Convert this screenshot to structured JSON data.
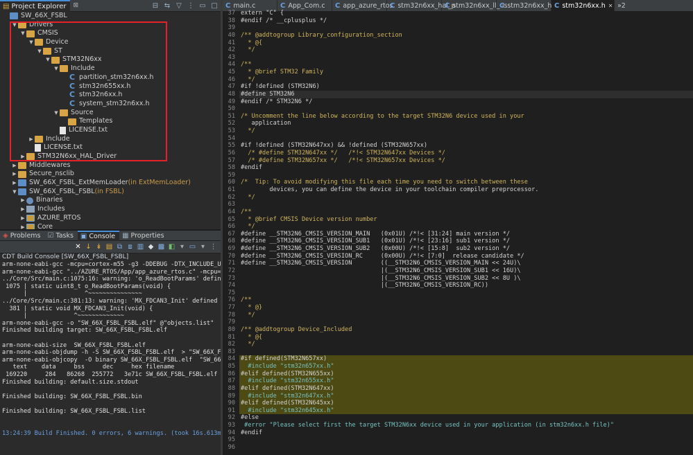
{
  "explorer": {
    "tabs": [
      {
        "label": "Project Explorer",
        "active": true
      },
      {
        "label": "⊠"
      }
    ],
    "tree": [
      {
        "label": "SW_66X_FSBL",
        "depth": 0,
        "icon": "project",
        "arrow": ""
      },
      {
        "label": "Drivers",
        "depth": 1,
        "icon": "folder",
        "arrow": "down"
      },
      {
        "label": "CMSIS",
        "depth": 2,
        "icon": "folder",
        "arrow": "down"
      },
      {
        "label": "Device",
        "depth": 3,
        "icon": "folder",
        "arrow": "down"
      },
      {
        "label": "ST",
        "depth": 4,
        "icon": "folder",
        "arrow": "down"
      },
      {
        "label": "STM32N6xx",
        "depth": 5,
        "icon": "folder",
        "arrow": "down"
      },
      {
        "label": "Include",
        "depth": 6,
        "icon": "folder",
        "arrow": "down"
      },
      {
        "label": "partition_stm32n6xx.h",
        "depth": 7,
        "icon": "c-file",
        "arrow": ""
      },
      {
        "label": "stm32n655xx.h",
        "depth": 7,
        "icon": "c-file",
        "arrow": ""
      },
      {
        "label": "stm32n6xx.h",
        "depth": 7,
        "icon": "c-file",
        "arrow": ""
      },
      {
        "label": "system_stm32n6xx.h",
        "depth": 7,
        "icon": "c-file",
        "arrow": ""
      },
      {
        "label": "Source",
        "depth": 6,
        "icon": "folder",
        "arrow": "down"
      },
      {
        "label": "Templates",
        "depth": 7,
        "icon": "folder",
        "arrow": ""
      },
      {
        "label": "LICENSE.txt",
        "depth": 6,
        "icon": "txt-file",
        "arrow": ""
      },
      {
        "label": "Include",
        "depth": 3,
        "icon": "folder",
        "arrow": "right"
      },
      {
        "label": "LICENSE.txt",
        "depth": 3,
        "icon": "txt-file",
        "arrow": ""
      },
      {
        "label": "STM32N6xx_HAL_Driver",
        "depth": 2,
        "icon": "folder",
        "arrow": "right"
      },
      {
        "label": "Middlewares",
        "depth": 1,
        "icon": "folder",
        "arrow": "right"
      },
      {
        "label": "Secure_nsclib",
        "depth": 1,
        "icon": "folder",
        "arrow": "right"
      },
      {
        "label": "SW_66X_FSBL_ExtMemLoader",
        "suffix": " (in ExtMemLoader)",
        "depth": 1,
        "icon": "project",
        "arrow": "right"
      },
      {
        "label": "SW_66X_FSBL_FSBL",
        "suffix": " (in FSBL)",
        "depth": 1,
        "icon": "project",
        "arrow": "down"
      },
      {
        "label": "Binaries",
        "depth": 2,
        "icon": "binaries",
        "arrow": "right"
      },
      {
        "label": "Includes",
        "depth": 2,
        "icon": "includes",
        "arrow": "right"
      },
      {
        "label": "AZURE_RTOS",
        "depth": 2,
        "icon": "folder-src",
        "arrow": "right"
      },
      {
        "label": "Core",
        "depth": 2,
        "icon": "folder-src",
        "arrow": "right"
      }
    ]
  },
  "console": {
    "tabs": [
      {
        "label": "Problems",
        "icon": "problems-icon"
      },
      {
        "label": "Tasks",
        "icon": "tasks-icon"
      },
      {
        "label": "Console",
        "icon": "console-icon",
        "active": true
      },
      {
        "label": "Properties",
        "icon": "properties-icon"
      }
    ],
    "title": "CDT Build Console [SW_66X_FSBL_FSBL]",
    "lines": [
      "arm-none-eabi-gcc -mcpu=cortex-m55 -g3 -DDEBUG -DTX_INCLUDE_USE",
      "arm-none-eabi-gcc \"../AZURE_RTOS/App/app_azure_rtos.c\" -mcpu=co",
      "../Core/Src/main.c:1075:16: warning: 'o_ReadBootParams' defined",
      " 1075 | static uint8_t o_ReadBootParams(void) {",
      "      |                ^~~~~~~~~~~~~~~~",
      "../Core/Src/main.c:381:13: warning: 'MX_FDCAN3_Init' defined bu",
      "  381 | static void MX_FDCAN3_Init(void) {",
      "      |             ^~~~~~~~~~~~~~",
      "arm-none-eabi-gcc -o \"SW_66X_FSBL_FSBL.elf\" @\"objects.list\"  -",
      "Finished building target: SW_66X_FSBL_FSBL.elf",
      "",
      "arm-none-eabi-size  SW_66X_FSBL_FSBL.elf",
      "arm-none-eabi-objdump -h -S SW_66X_FSBL_FSBL.elf  > \"SW_66X_FSB",
      "arm-none-eabi-objcopy  -O binary SW_66X_FSBL_FSBL.elf  \"SW_66X_",
      "   text    data     bss     dec     hex filename",
      " 169220     284   86268  255772   3e71c SW_66X_FSBL_FSBL.elf",
      "Finished building: default.size.stdout",
      "",
      "Finished building: SW_66X_FSBL_FSBL.bin",
      "",
      "Finished building: SW_66X_FSBL_FSBL.list",
      "",
      "",
      "13:24:39 Build Finished. 0 errors, 6 warnings. (took 16s.613ms)"
    ]
  },
  "editor": {
    "tabs": [
      {
        "label": "main.c"
      },
      {
        "label": "App_Com.c"
      },
      {
        "label": "app_azure_rtos."
      },
      {
        "label": "stm32n6xx_hal_p"
      },
      {
        "label": "stm32n6xx_ll_us"
      },
      {
        "label": "stm32n6xx_hal_d"
      },
      {
        "label": "stm32n6xx.h",
        "active": true
      },
      {
        "label": "»2",
        "overflow": true
      }
    ],
    "lines": [
      {
        "n": "37",
        "t": "extern \"C\" {"
      },
      {
        "n": "38",
        "t": "#endif /* __cplusplus */"
      },
      {
        "n": "39",
        "t": ""
      },
      {
        "n": "40",
        "t": "/** @addtogroup Library_configuration_section"
      },
      {
        "n": "41",
        "t": "  * @{"
      },
      {
        "n": "42",
        "t": "  */"
      },
      {
        "n": "43",
        "t": ""
      },
      {
        "n": "44",
        "t": "/**"
      },
      {
        "n": "45",
        "t": "  * @brief STM32 Family"
      },
      {
        "n": "46",
        "t": "  */"
      },
      {
        "n": "47",
        "t": "#if !defined (STM32N6)"
      },
      {
        "n": "48",
        "t": "#define STM32N6",
        "cur": true
      },
      {
        "n": "49",
        "t": "#endif /* STM32N6 */"
      },
      {
        "n": "50",
        "t": ""
      },
      {
        "n": "51",
        "t": "/* Uncomment the line below according to the target STM32N6 device used in your"
      },
      {
        "n": "52",
        "t": "   application"
      },
      {
        "n": "53",
        "t": "  */"
      },
      {
        "n": "54",
        "t": ""
      },
      {
        "n": "55",
        "t": "#if !defined (STM32N647xx) && !defined (STM32N657xx)"
      },
      {
        "n": "56",
        "t": "  /* #define STM32N647xx */   /*!< STM32N647xx Devices */"
      },
      {
        "n": "57",
        "t": "  /* #define STM32N657xx */   /*!< STM32N657xx Devices */"
      },
      {
        "n": "58",
        "t": "#endif"
      },
      {
        "n": "59",
        "t": ""
      },
      {
        "n": "60",
        "t": "/*  Tip: To avoid modifying this file each time you need to switch between these"
      },
      {
        "n": "61",
        "t": "        devices, you can define the device in your toolchain compiler preprocessor."
      },
      {
        "n": "62",
        "t": "  */"
      },
      {
        "n": "63",
        "t": ""
      },
      {
        "n": "64",
        "t": "/**"
      },
      {
        "n": "65",
        "t": "  * @brief CMSIS Device version number"
      },
      {
        "n": "66",
        "t": "  */"
      },
      {
        "n": "67",
        "t": "#define __STM32N6_CMSIS_VERSION_MAIN   (0x01U) /*!< [31:24] main version */"
      },
      {
        "n": "68",
        "t": "#define __STM32N6_CMSIS_VERSION_SUB1   (0x01U) /*!< [23:16] sub1 version */"
      },
      {
        "n": "69",
        "t": "#define __STM32N6_CMSIS_VERSION_SUB2   (0x00U) /*!< [15:8]  sub2 version */"
      },
      {
        "n": "70",
        "t": "#define __STM32N6_CMSIS_VERSION_RC     (0x00U) /*!< [7:0]  release candidate */"
      },
      {
        "n": "71",
        "t": "#define __STM32N6_CMSIS_VERSION        ((__STM32N6_CMSIS_VERSION_MAIN << 24U)\\"
      },
      {
        "n": "72",
        "t": "                                       |(__STM32N6_CMSIS_VERSION_SUB1 << 16U)\\"
      },
      {
        "n": "73",
        "t": "                                       |(__STM32N6_CMSIS_VERSION_SUB2 << 8U )\\"
      },
      {
        "n": "74",
        "t": "                                       |(__STM32N6_CMSIS_VERSION_RC))"
      },
      {
        "n": "75",
        "t": ""
      },
      {
        "n": "76",
        "t": "/**"
      },
      {
        "n": "77",
        "t": "  * @}"
      },
      {
        "n": "78",
        "t": "  */"
      },
      {
        "n": "79",
        "t": ""
      },
      {
        "n": "80",
        "t": "/** @addtogroup Device_Included"
      },
      {
        "n": "81",
        "t": "  * @{"
      },
      {
        "n": "82",
        "t": "  */"
      },
      {
        "n": "83",
        "t": ""
      },
      {
        "n": "84",
        "t": "#if defined(STM32N657xx)",
        "hl": true
      },
      {
        "n": "85",
        "t": "  #include \"stm32n657xx.h\"",
        "hl": true
      },
      {
        "n": "86",
        "t": "#elif defined(STM32N655xx)",
        "hl": true
      },
      {
        "n": "87",
        "t": "  #include \"stm32n655xx.h\"",
        "hl": true
      },
      {
        "n": "88",
        "t": "#elif defined(STM32N647xx)",
        "hl": true
      },
      {
        "n": "89",
        "t": "  #include \"stm32n647xx.h\"",
        "hl": true
      },
      {
        "n": "90",
        "t": "#elif defined(STM32N645xx)",
        "hl": true
      },
      {
        "n": "91",
        "t": "  #include \"stm32n645xx.h\"",
        "hl": true
      },
      {
        "n": "92",
        "t": "#else"
      },
      {
        "n": "93",
        "t": " #error \"Please select first the target STM32N6xx device used in your application (in stm32n6xx.h file)\""
      },
      {
        "n": "94",
        "t": "#endif"
      },
      {
        "n": "95",
        "t": ""
      },
      {
        "n": "96",
        "t": ""
      }
    ]
  },
  "colors": {
    "highlight_box": "#e8202a",
    "highlighted_code_bg": "#4d4a14",
    "accent": "#4a90d9"
  }
}
